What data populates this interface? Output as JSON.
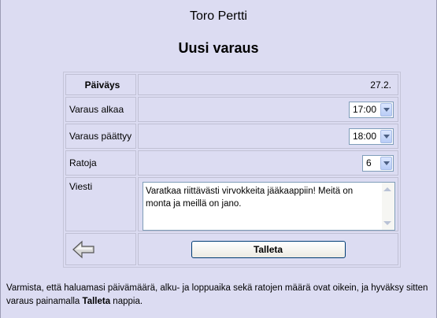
{
  "header": {
    "user_name": "Toro Pertti",
    "page_title": "Uusi varaus"
  },
  "form": {
    "date_label": "Päiväys",
    "date_value": "27.2.",
    "start_label": "Varaus alkaa",
    "start_value": "17:00",
    "end_label": "Varaus päättyy",
    "end_value": "18:00",
    "tracks_label": "Ratoja",
    "tracks_value": "6",
    "message_label": "Viesti",
    "message_value": "Varatkaa riittävästi virvokkeita jääkaappiin! Meitä on monta ja meillä on jano."
  },
  "actions": {
    "back_icon": "back-arrow-icon",
    "save_label": "Talleta"
  },
  "footer": {
    "help_text_1": "Varmista, että haluamasi päivämäärä, alku- ja loppuaika sekä ratojen määrä ovat oikein, ja hyväksy sitten varaus painamalla ",
    "help_bold": "Talleta",
    "help_text_2": " nappia."
  },
  "colors": {
    "background": "#dcdcf2",
    "select_border": "#7f9db9",
    "button_border": "#003c74"
  }
}
